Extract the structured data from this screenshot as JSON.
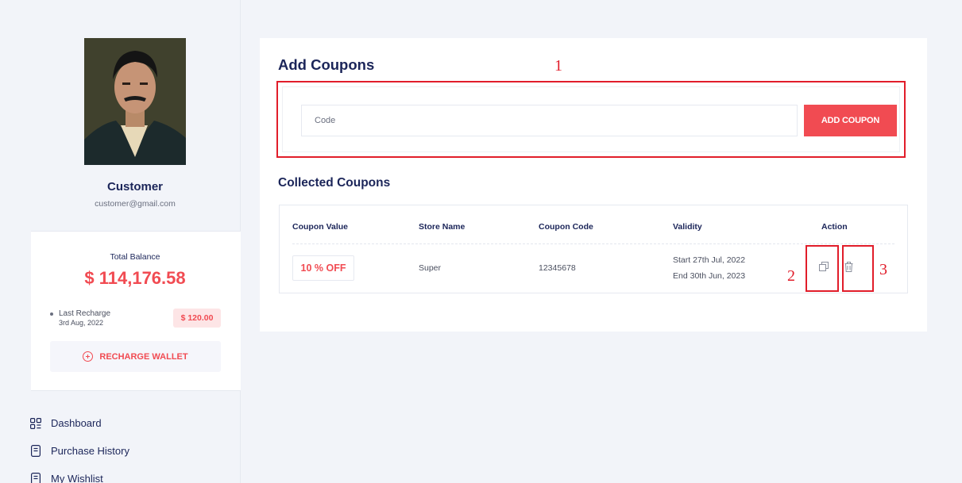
{
  "profile": {
    "name": "Customer",
    "email": "customer@gmail.com"
  },
  "wallet": {
    "total_balance_label": "Total Balance",
    "total_balance_value": "$ 114,176.58",
    "last_recharge_label": "Last Recharge",
    "last_recharge_date": "3rd Aug, 2022",
    "last_recharge_amount": "$ 120.00",
    "recharge_button": "RECHARGE WALLET"
  },
  "nav": {
    "items": [
      {
        "label": "Dashboard",
        "icon": "dashboard-icon"
      },
      {
        "label": "Purchase History",
        "icon": "receipt-icon"
      },
      {
        "label": "My Wishlist",
        "icon": "receipt-icon"
      }
    ]
  },
  "add_coupons": {
    "title": "Add Coupons",
    "input_placeholder": "Code",
    "input_value": "",
    "button_label": "ADD COUPON"
  },
  "collected": {
    "title": "Collected Coupons",
    "headers": [
      "Coupon Value",
      "Store Name",
      "Coupon Code",
      "Validity",
      "Action"
    ],
    "rows": [
      {
        "value": "10 % OFF",
        "store": "Super",
        "code": "12345678",
        "validity_start": "Start 27th Jul, 2022",
        "validity_end": "End 30th Jun, 2023",
        "actions": [
          "copy-icon",
          "trash-icon"
        ]
      }
    ]
  },
  "annotations": {
    "n1": "1",
    "n2": "2",
    "n3": "3"
  },
  "colors": {
    "accent": "#f14b52",
    "annotation": "#e11d2a",
    "text_primary": "#1b2559",
    "background": "#f2f4f9"
  }
}
